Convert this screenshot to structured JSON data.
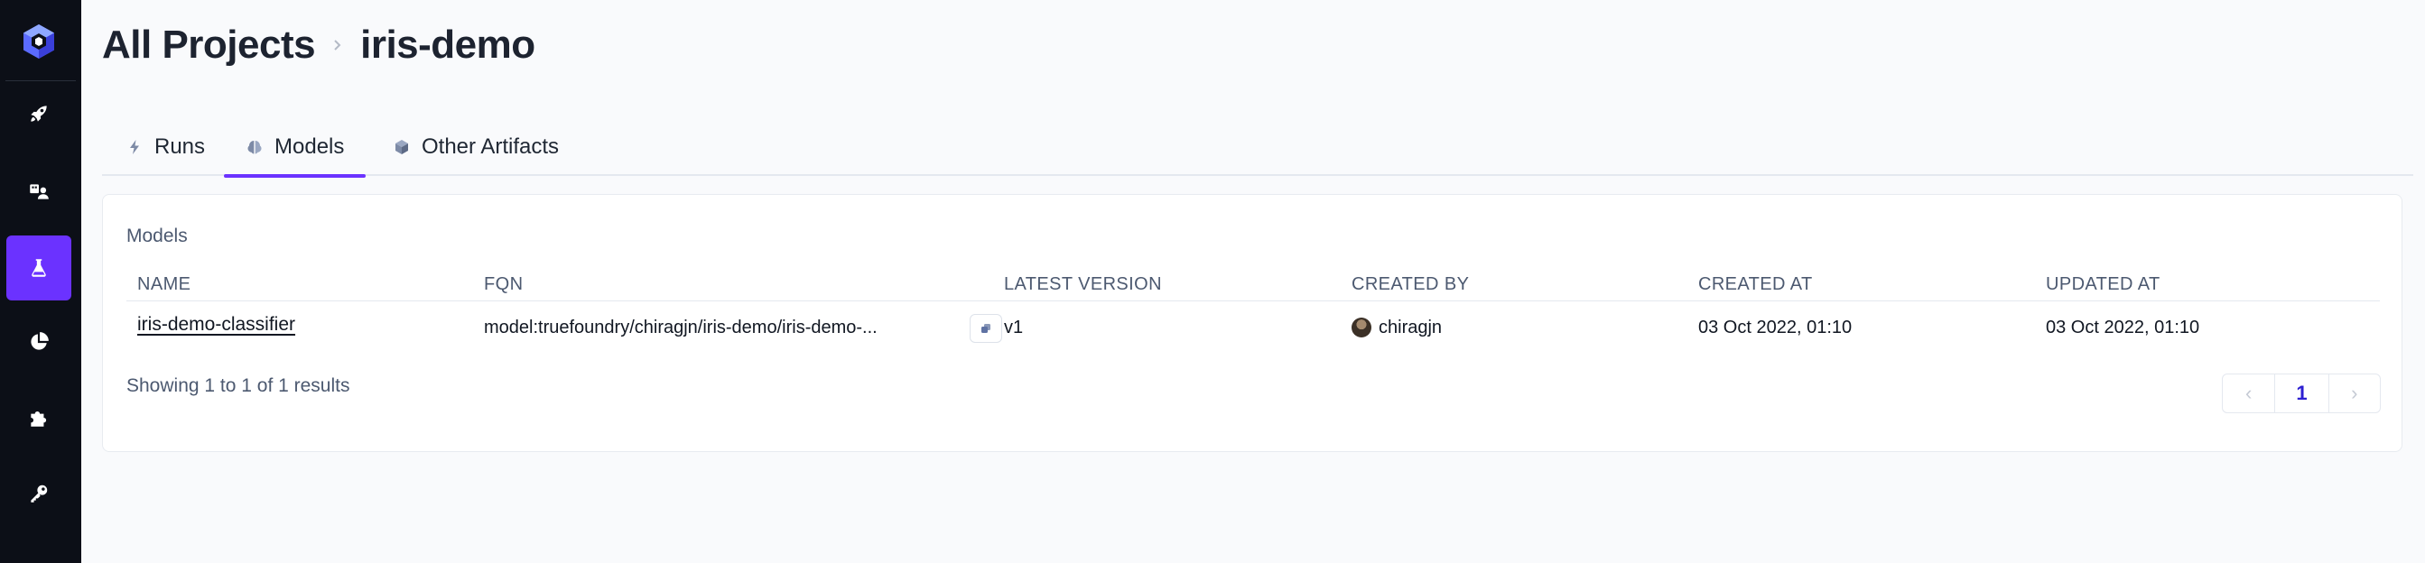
{
  "colors": {
    "accent": "#6b32ff",
    "sidebar_bg": "#0c0f17",
    "page_bg": "#f9fafc",
    "link": "#2d1fd1"
  },
  "sidebar": {
    "logo": "truefoundry-logo",
    "items": [
      {
        "icon": "rocket-icon",
        "active": false
      },
      {
        "icon": "deployments-icon",
        "active": false
      },
      {
        "icon": "flask-icon",
        "active": true
      },
      {
        "icon": "pie-chart-icon",
        "active": false
      },
      {
        "icon": "puzzle-icon",
        "active": false
      },
      {
        "icon": "key-icon",
        "active": false
      }
    ]
  },
  "breadcrumb": {
    "root": "All Projects",
    "current": "iris-demo"
  },
  "tabs": [
    {
      "label": "Runs",
      "icon": "lightning-icon",
      "active": false
    },
    {
      "label": "Models",
      "icon": "brain-icon",
      "active": true
    },
    {
      "label": "Other Artifacts",
      "icon": "cube-icon",
      "active": false
    }
  ],
  "card": {
    "title": "Models",
    "columns": [
      "NAME",
      "FQN",
      "LATEST VERSION",
      "CREATED BY",
      "CREATED AT",
      "UPDATED AT"
    ],
    "rows": [
      {
        "name": "iris-demo-classifier",
        "fqn": "model:truefoundry/chiragjn/iris-demo/iris-demo-...",
        "latest_version": "v1",
        "created_by": "chiragjn",
        "created_at": "03 Oct 2022, 01:10",
        "updated_at": "03 Oct 2022, 01:10"
      }
    ],
    "showing": "Showing 1 to 1 of 1 results",
    "pagination": {
      "prev": "‹",
      "current_page": "1",
      "next": "›"
    }
  }
}
